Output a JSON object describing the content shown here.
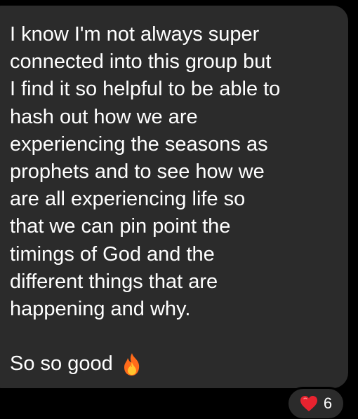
{
  "message": {
    "body": "I know I'm not always super\nconnected into this group but\nI find it so helpful to be able to\nhash out how we are\nexperiencing the seasons as\nprophets and to see how we\nare all experiencing life so\nthat we can pin point the\ntimings of God and the\ndifferent things that are\nhappening and why.",
    "signoff": "So so good",
    "signoff_icon": "fire-emoji"
  },
  "reaction": {
    "icon": "red-heart-emoji",
    "count": "6"
  },
  "colors": {
    "background": "#000000",
    "bubble": "#2b2b2b",
    "text": "#ffffff",
    "heart": "#e8232f"
  }
}
